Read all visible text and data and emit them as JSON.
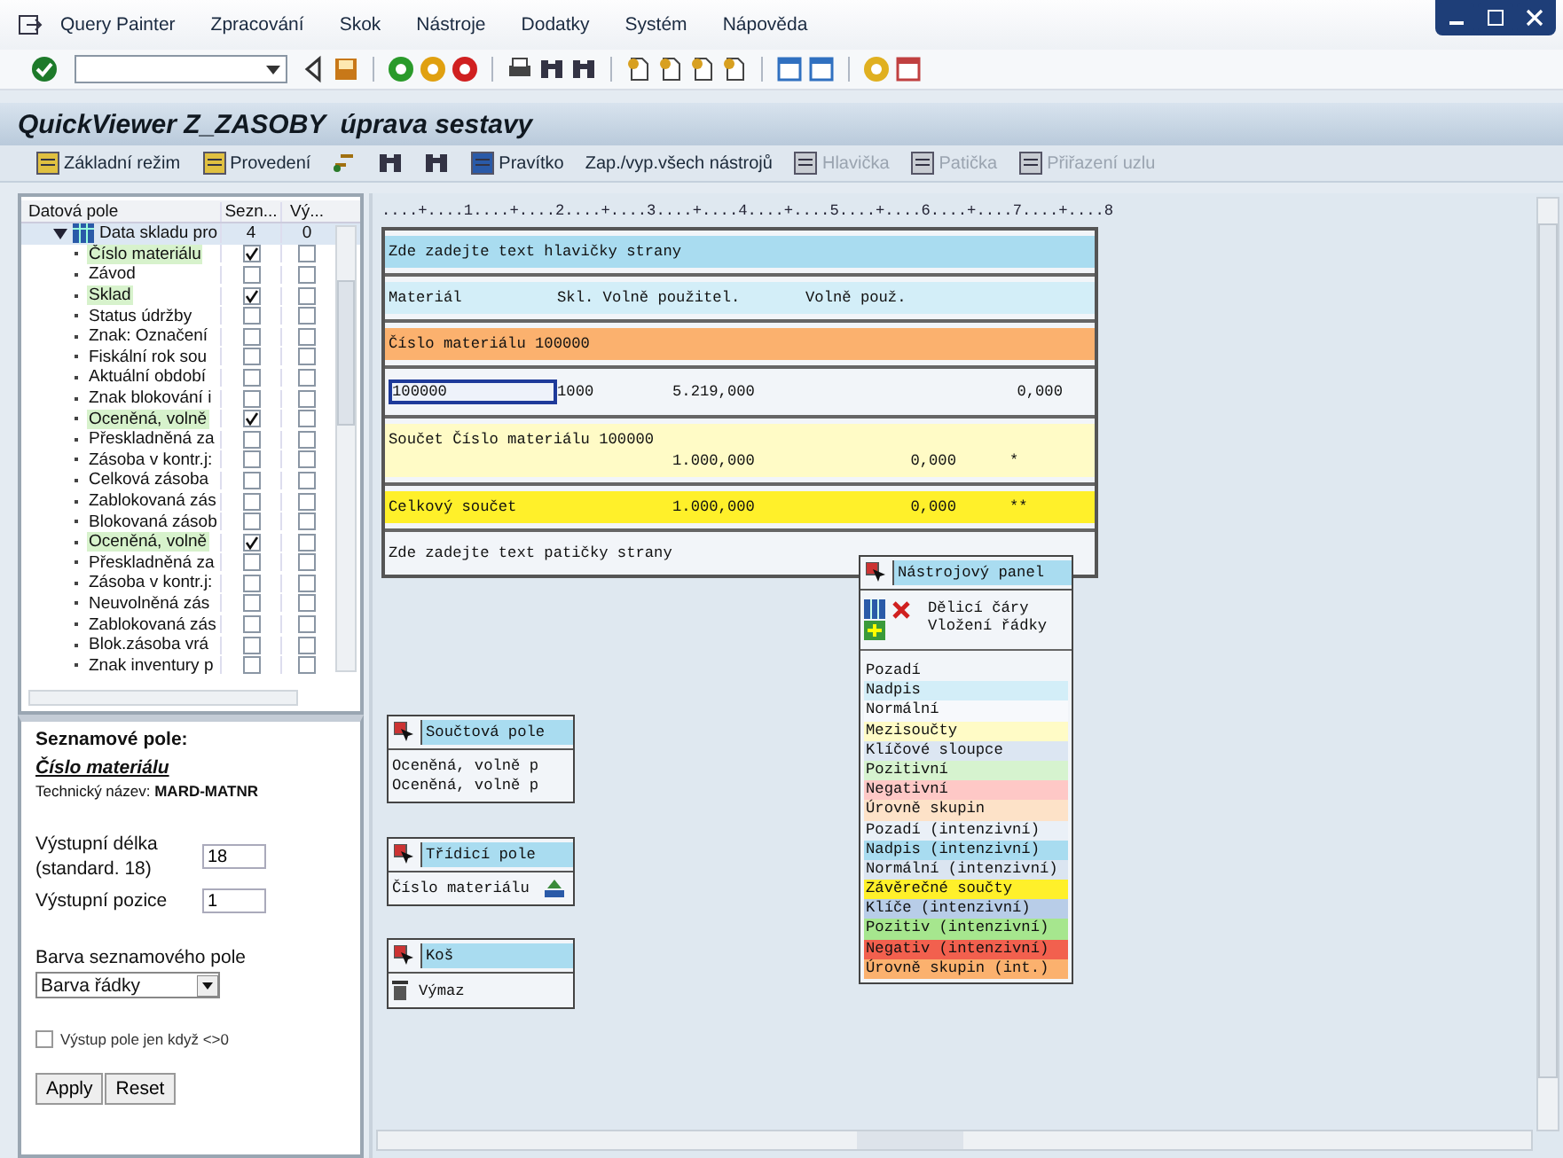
{
  "menu": [
    "Query Painter",
    "Zpracování",
    "Skok",
    "Nástroje",
    "Dodatky",
    "Systém",
    "Nápověda"
  ],
  "title": "QuickViewer Z_ZASOBY  úprava sestavy",
  "app_toolbar": [
    {
      "kind": "button",
      "label": "Základní režim",
      "disabled": false
    },
    {
      "kind": "button",
      "label": "Provedení",
      "disabled": false
    },
    {
      "kind": "icon",
      "disabled": false
    },
    {
      "kind": "icon",
      "disabled": false
    },
    {
      "kind": "icon",
      "disabled": false
    },
    {
      "kind": "button",
      "label": "Pravítko",
      "disabled": false
    },
    {
      "kind": "text",
      "label": "Zap./vyp.všech nástrojů",
      "disabled": false
    },
    {
      "kind": "button",
      "label": "Hlavička",
      "disabled": true
    },
    {
      "kind": "button",
      "label": "Patička",
      "disabled": true
    },
    {
      "kind": "button",
      "label": "Přiřazení uzlu",
      "disabled": true
    }
  ],
  "tree": {
    "columns": [
      "Datová pole",
      "Sezn...",
      "Vý..."
    ],
    "root": {
      "label": "Data skladu pro",
      "list_count": "4",
      "output_count": "0",
      "expanded": true,
      "children": [
        {
          "label": "Číslo materiálu",
          "list": true,
          "output": false
        },
        {
          "label": "Závod",
          "list": false,
          "output": false
        },
        {
          "label": "Sklad",
          "list": true,
          "output": false
        },
        {
          "label": "Status údržby",
          "list": false,
          "output": false
        },
        {
          "label": "Znak: Označení",
          "list": false,
          "output": false
        },
        {
          "label": "Fiskální rok sou",
          "list": false,
          "output": false
        },
        {
          "label": "Aktuální období",
          "list": false,
          "output": false
        },
        {
          "label": "Znak blokování i",
          "list": false,
          "output": false
        },
        {
          "label": "Oceněná, volně",
          "list": true,
          "output": false
        },
        {
          "label": "Přeskladněná za",
          "list": false,
          "output": false
        },
        {
          "label": "Zásoba v kontr.j:",
          "list": false,
          "output": false
        },
        {
          "label": "Celková zásoba",
          "list": false,
          "output": false
        },
        {
          "label": "Zablokovaná zás",
          "list": false,
          "output": false
        },
        {
          "label": "Blokovaná zásob",
          "list": false,
          "output": false
        },
        {
          "label": "Oceněná, volně",
          "list": true,
          "output": false
        },
        {
          "label": "Přeskladněná za",
          "list": false,
          "output": false
        },
        {
          "label": "Zásoba v kontr.j:",
          "list": false,
          "output": false
        },
        {
          "label": "Neuvolněná zás",
          "list": false,
          "output": false
        },
        {
          "label": "Zablokovaná zás",
          "list": false,
          "output": false
        },
        {
          "label": "Blok.zásoba vrá",
          "list": false,
          "output": false
        },
        {
          "label": "Znak inventury p",
          "list": false,
          "output": false
        }
      ]
    }
  },
  "properties": {
    "heading": "Seznamové pole:",
    "field": "Číslo materiálu",
    "technical": "Technický název: **MARD-MATNR**",
    "length_label": "Výstupní délka (standard. 18)",
    "length_value": "18",
    "position_label": "Výstupní pozice",
    "position_value": "1",
    "color_label": "Barva seznamového pole",
    "color_value": "Barva řádky",
    "nonzero_label": "Výstup pole jen když <>0",
    "nonzero_checked": false,
    "buttons": [
      "Apply",
      "Reset"
    ]
  },
  "report": {
    "ruler": "....+....1....+....2....+....3....+....4....+....5....+....6....+....7....+....8",
    "rows": [
      {
        "kind": "header",
        "focused": false,
        "lines": [
          {
            "column_1": "Zde zadejte text hlavičky strany"
          }
        ]
      },
      {
        "kind": "columns",
        "focused": false,
        "lines": [
          {
            "column_1": "Materiál",
            "column_2": "Skl. Volně použitel.",
            "column_4": "Volně použ."
          }
        ]
      },
      {
        "kind": "group",
        "focused": false,
        "lines": [
          {
            "column_1": "Číslo materiálu 100000"
          }
        ]
      },
      {
        "kind": "data",
        "focused": true,
        "lines": [
          {
            "column_1": "100000",
            "column_2": "1000",
            "column_3": "5.219,000",
            "column_4": "0,000"
          }
        ]
      },
      {
        "kind": "subtotal",
        "focused": false,
        "lines": [
          {
            "column_1": "Součet Číslo materiálu 100000"
          },
          {
            "column_3": "1.000,000",
            "column_4": "0,000",
            "column_5": "*"
          }
        ]
      },
      {
        "kind": "total",
        "focused": false,
        "lines": [
          {
            "column_1": "Celkový součet",
            "column_3": "1.000,000",
            "column_4": "0,000",
            "column_5": "**"
          }
        ]
      },
      {
        "kind": "footer",
        "focused": false,
        "lines": [
          {
            "column_1": "Zde zadejte text patičky strany"
          }
        ]
      }
    ]
  },
  "panels": [
    {
      "kind": "sum",
      "title": "Součtová pole",
      "items": [
        "Oceněná, volně p",
        "Oceněná, volně p"
      ]
    },
    {
      "kind": "sort",
      "title": "Třídicí pole",
      "items": [
        "Číslo materiálu"
      ]
    },
    {
      "kind": "trash",
      "title": "Koš",
      "items": [
        "Výmaz"
      ]
    }
  ],
  "toolbox": {
    "title": "Nástrojový panel",
    "tools": [
      "Dělicí čáry",
      "Vložení řádky"
    ],
    "colors": [
      {
        "name": "Pozadí",
        "color": "#f2f5f9"
      },
      {
        "name": "Nadpis",
        "color": "#d3eef8"
      },
      {
        "name": "Normální",
        "color": "#f7f9fc"
      },
      {
        "name": "Mezisoučty",
        "color": "#fffbc6"
      },
      {
        "name": "Klíčové sloupce",
        "color": "#dce6f2"
      },
      {
        "name": "Pozitivní",
        "color": "#d6f3cf"
      },
      {
        "name": "Negativní",
        "color": "#fec8c6"
      },
      {
        "name": "Úrovně skupin",
        "color": "#fde2c8"
      },
      {
        "name": "Pozadí (intenzivní)",
        "color": "#eaf0f7"
      },
      {
        "name": "Nadpis (intenzivní)",
        "color": "#a8dcf0"
      },
      {
        "name": "Normální (intenzivní)",
        "color": "#dbe5f1"
      },
      {
        "name": "Závěrečné součty",
        "color": "#fff02a"
      },
      {
        "name": "Klíče (intenzivní)",
        "color": "#b8cde8"
      },
      {
        "name": "Pozitiv (intenzivní)",
        "color": "#a6e68e"
      },
      {
        "name": "Negativ (intenzivní)",
        "color": "#f2604e"
      },
      {
        "name": "Úrovně skupin (int.)",
        "color": "#fbb16e"
      }
    ]
  }
}
